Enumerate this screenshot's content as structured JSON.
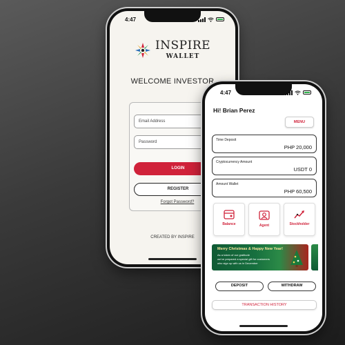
{
  "status_bar": {
    "time": "4:47"
  },
  "login_screen": {
    "brand": "INSPIRE",
    "brand_sub": "WALLET",
    "welcome": "WELCOME INVESTOR",
    "email_placeholder": "Email Address",
    "password_placeholder": "Password",
    "login_label": "LOGIN",
    "register_label": "REGISTER",
    "forgot_label": "Forgot Password?",
    "footer": "CREATED BY INSPIRE"
  },
  "dashboard": {
    "greeting": "Hi! Brian Perez",
    "menu_label": "MENU",
    "cards": [
      {
        "label": "Time Deposit",
        "value": "PHP 20,000"
      },
      {
        "label": "Cryptocurrency Amount",
        "value": "USDT 0"
      },
      {
        "label": "Amount Wallet",
        "value": "PHP 60,500"
      }
    ],
    "tiles": [
      {
        "label": "Balance",
        "icon": "balance-icon"
      },
      {
        "label": "Agent",
        "icon": "agent-icon"
      },
      {
        "label": "Stockholder",
        "icon": "stockholder-icon"
      }
    ],
    "promo": {
      "title": "Merry Christmas & Happy New Year!",
      "line1": "As a token of our gratitude",
      "line2": "we've prepared a special gift for customers",
      "line3": "who sign up with us in December"
    },
    "deposit_label": "DEPOSIT",
    "withdraw_label": "WITHDRAW",
    "history_label": "TRANSACTION HISTORY"
  },
  "colors": {
    "accent": "#d0223a",
    "background": "#3a3a3a"
  }
}
